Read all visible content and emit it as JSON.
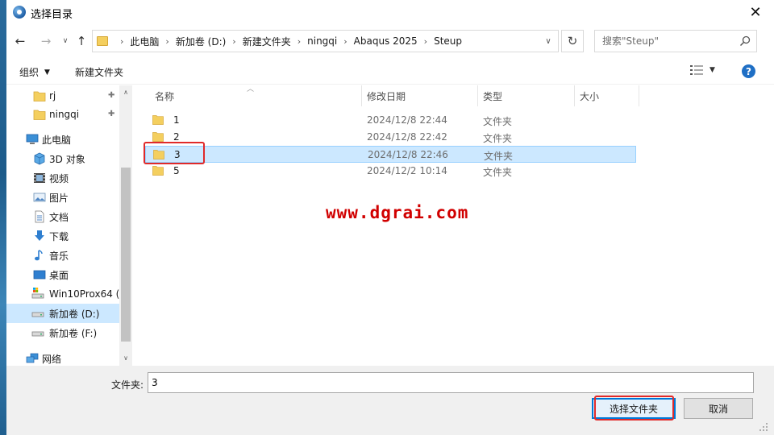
{
  "window": {
    "title": "选择目录",
    "close_glyph": "✕"
  },
  "nav": {
    "back_glyph": "←",
    "forward_glyph": "→",
    "recent_glyph": "∨",
    "up_glyph": "↑",
    "breadcrumbs": [
      "此电脑",
      "新加卷 (D:)",
      "新建文件夹",
      "ningqi",
      "Abaqus 2025",
      "Steup"
    ],
    "crumb_sep": "›",
    "dropdown_glyph": "∨",
    "refresh_glyph": "↻",
    "search_placeholder": "搜索\"Steup\""
  },
  "toolbar": {
    "organize_label": "组织",
    "organize_caret": "▼",
    "new_folder_label": "新建文件夹",
    "view_caret": "▼",
    "help_label": "?"
  },
  "sidebar": {
    "pin_glyph": "✚",
    "items": [
      {
        "label": "rj",
        "icon": "folder-icon",
        "pinned": true
      },
      {
        "label": "ningqi",
        "icon": "folder-icon",
        "pinned": true
      },
      {
        "label": "此电脑",
        "icon": "computer-icon"
      },
      {
        "label": "3D 对象",
        "icon": "cube-icon"
      },
      {
        "label": "视频",
        "icon": "video-icon"
      },
      {
        "label": "图片",
        "icon": "picture-icon"
      },
      {
        "label": "文档",
        "icon": "document-icon"
      },
      {
        "label": "下载",
        "icon": "download-icon"
      },
      {
        "label": "音乐",
        "icon": "music-icon"
      },
      {
        "label": "桌面",
        "icon": "desktop-icon"
      },
      {
        "label": "Win10Prox64 (C",
        "icon": "drive-icon"
      },
      {
        "label": "新加卷 (D:)",
        "icon": "drive-icon",
        "selected": true
      },
      {
        "label": "新加卷 (F:)",
        "icon": "drive-icon"
      },
      {
        "label": "网络",
        "icon": "network-icon"
      }
    ],
    "scroll_up_glyph": "∧",
    "scroll_down_glyph": "∨"
  },
  "file_list": {
    "sort_glyph": "︿",
    "columns": [
      "名称",
      "修改日期",
      "类型",
      "大小"
    ],
    "rows": [
      {
        "name": "1",
        "date": "2024/12/8 22:44",
        "type": "文件夹",
        "size": ""
      },
      {
        "name": "2",
        "date": "2024/12/8 22:42",
        "type": "文件夹",
        "size": ""
      },
      {
        "name": "3",
        "date": "2024/12/8 22:46",
        "type": "文件夹",
        "size": "",
        "selected": true
      },
      {
        "name": "5",
        "date": "2024/12/2 10:14",
        "type": "文件夹",
        "size": ""
      }
    ]
  },
  "watermark": "www.dgrai.com",
  "footer": {
    "folder_label": "文件夹:",
    "folder_value": "3",
    "select_label": "选择文件夹",
    "cancel_label": "取消"
  },
  "colors": {
    "selection_bg": "#cce8ff",
    "accent": "#0078d7",
    "annotation_red": "#e02a2a",
    "folder_yellow": "#f4cf5f"
  }
}
